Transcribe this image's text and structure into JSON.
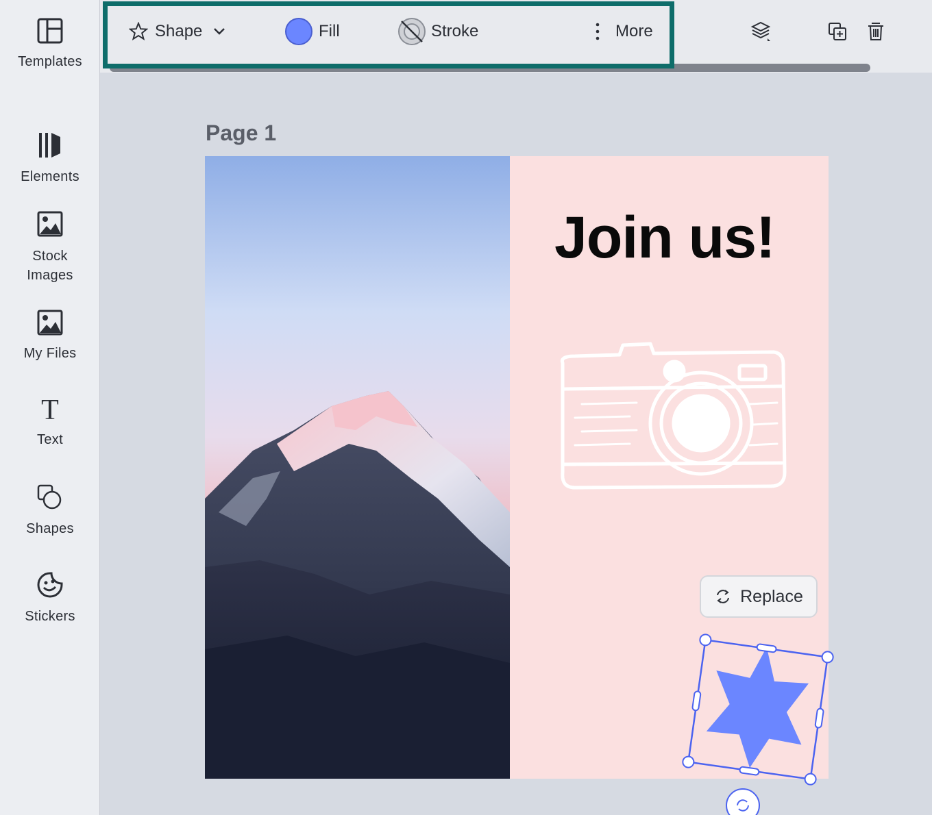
{
  "sidebar": {
    "items": [
      {
        "label": "Templates",
        "icon": "templates-icon"
      },
      {
        "label": "Elements",
        "icon": "elements-icon"
      },
      {
        "label": "Stock",
        "label2": "Images",
        "icon": "stock-images-icon"
      },
      {
        "label": "My Files",
        "icon": "my-files-icon"
      },
      {
        "label": "Text",
        "icon": "text-icon"
      },
      {
        "label": "Shapes",
        "icon": "shapes-icon"
      },
      {
        "label": "Stickers",
        "icon": "stickers-icon"
      }
    ]
  },
  "toolbar": {
    "shape_label": "Shape",
    "fill_label": "Fill",
    "stroke_label": "Stroke",
    "more_label": "More",
    "fill_color": "#6b86ff",
    "highlight_color": "#0e6d6a"
  },
  "canvas": {
    "page_label": "Page 1",
    "headline": "Join us!",
    "replace_label": "Replace",
    "page_background": "#fbe0e0",
    "star_color": "#6b86ff",
    "selection_color": "#4b63f0"
  }
}
